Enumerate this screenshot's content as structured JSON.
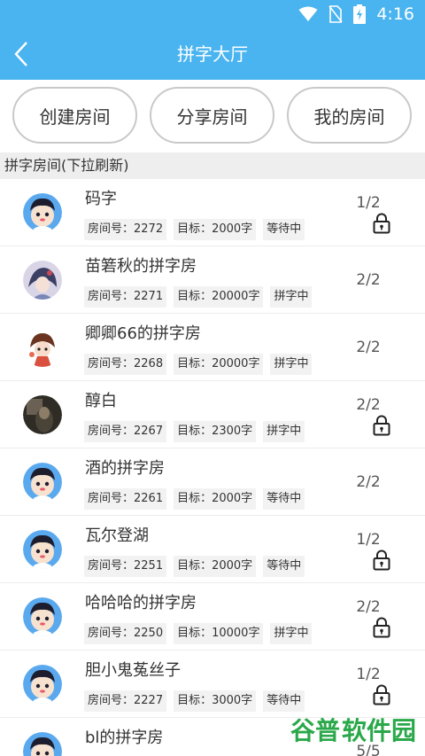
{
  "status_bar": {
    "time": "4:16"
  },
  "app_bar": {
    "title": "拼字大厅"
  },
  "buttons": {
    "create": "创建房间",
    "share": "分享房间",
    "mine": "我的房间"
  },
  "section": {
    "title": "拼字房间(下拉刷新)"
  },
  "colors": {
    "primary": "#4ab4f0",
    "tag_bg": "#f2f2f2",
    "section_bg": "#eeeeee"
  },
  "rooms": [
    {
      "name": "码字",
      "room_no": "房间号：2272",
      "target": "目标：2000字",
      "status": "等待中",
      "count": "1/2",
      "locked": true,
      "avatar": "cartoon-boy"
    },
    {
      "name": "苗箬秋的拼字房",
      "room_no": "房间号：2271",
      "target": "目标：20000字",
      "status": "拼字中",
      "count": "2/2",
      "locked": false,
      "avatar": "anime-girl"
    },
    {
      "name": "卿卿66的拼字房",
      "room_no": "房间号：2268",
      "target": "目标：20000字",
      "status": "拼字中",
      "count": "2/2",
      "locked": false,
      "avatar": "chibi-girl"
    },
    {
      "name": "醇白",
      "room_no": "房间号：2267",
      "target": "目标：2300字",
      "status": "拼字中",
      "count": "2/2",
      "locked": true,
      "avatar": "dark-photo"
    },
    {
      "name": "酒的拼字房",
      "room_no": "房间号：2261",
      "target": "目标：2000字",
      "status": "等待中",
      "count": "2/2",
      "locked": false,
      "avatar": "cartoon-boy"
    },
    {
      "name": "瓦尔登湖",
      "room_no": "房间号：2251",
      "target": "目标：2000字",
      "status": "等待中",
      "count": "1/2",
      "locked": true,
      "avatar": "cartoon-boy"
    },
    {
      "name": "哈哈哈的拼字房",
      "room_no": "房间号：2250",
      "target": "目标：10000字",
      "status": "拼字中",
      "count": "2/2",
      "locked": true,
      "avatar": "cartoon-boy"
    },
    {
      "name": "胆小鬼菟丝子",
      "room_no": "房间号：2227",
      "target": "目标：3000字",
      "status": "等待中",
      "count": "1/2",
      "locked": true,
      "avatar": "cartoon-boy"
    },
    {
      "name": "bl的拼字房",
      "room_no": "",
      "target": "",
      "status": "",
      "count": "5/5",
      "locked": false,
      "avatar": "cartoon-boy"
    }
  ],
  "watermark": {
    "part1": "谷普",
    "part2": "软件园"
  }
}
